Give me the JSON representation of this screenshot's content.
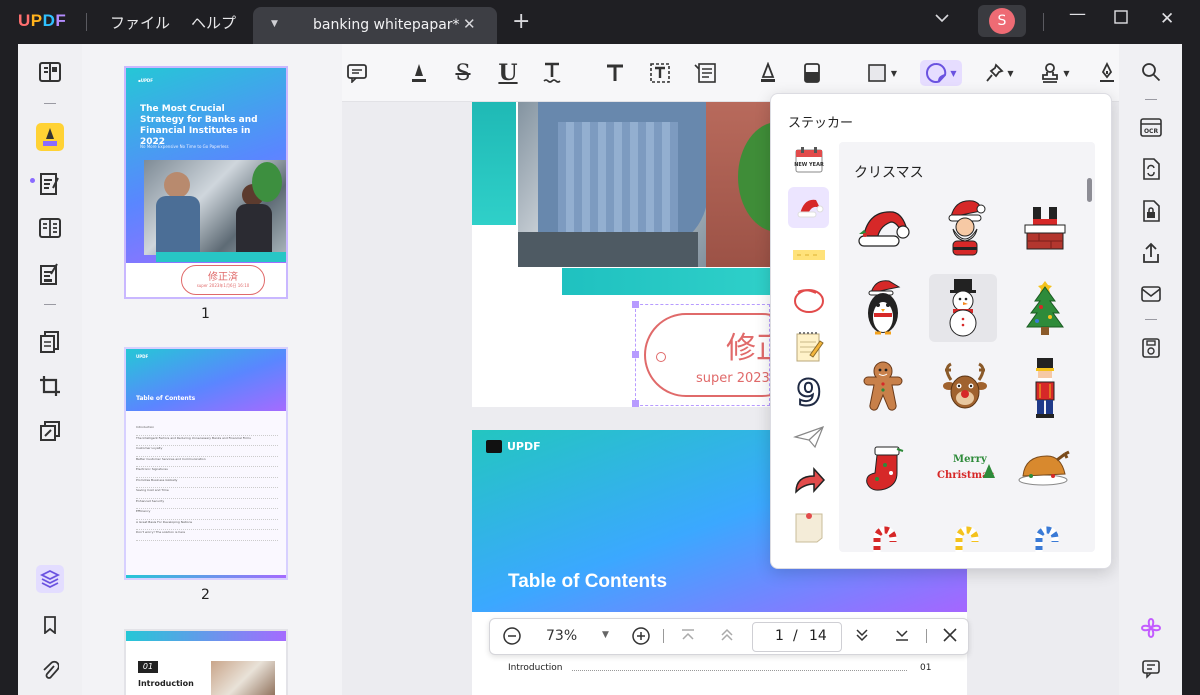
{
  "app": {
    "logo": "UPDF",
    "menus": [
      "ファイル",
      "ヘルプ"
    ],
    "tab_title": "banking whitepapar*",
    "avatar_initial": "S"
  },
  "thumbnails": [
    {
      "page": "1",
      "title": "The Most Crucial Strategy for Banks and Financial Institutes in 2022",
      "subtitle": "No More Expensive No Time to Go Paperless",
      "stamp_main": "修正済",
      "stamp_sub": "super 2023年1月6日 16:10"
    },
    {
      "page": "2",
      "header": "UPDF",
      "title": "Table of Contents",
      "entries": [
        "Introduction",
        "The Intelligent Factors and Reducing Unnecessary Banks and Financial Firms",
        "Customer Loyalty",
        "Better Customer Services and Communication",
        "Electronic Signatures",
        "Promotes Business Globally",
        "Saving Cost and Time",
        "Enhanced Security",
        "Efficiency",
        "A Great Basis For Developing Nations",
        "Don't worry! The solution is here"
      ]
    },
    {
      "page": "3",
      "badge": "01",
      "title": "Introduction"
    }
  ],
  "document": {
    "stamp_main": "修正",
    "stamp_sub": "super 2023年",
    "page2_logo": "UPDF",
    "page2_title": "Table of Contents",
    "toc_first_label": "Introduction",
    "toc_first_page": "01"
  },
  "sticker_panel": {
    "title": "ステッカー",
    "selected_category": "クリスマス",
    "category_icons": [
      "calendar-new-year",
      "santa-hat",
      "washi-tape",
      "red-circle",
      "notepad",
      "number-nine",
      "paper-plane",
      "red-arrow",
      "pinned-note"
    ],
    "new_year_label": "NEW YEAR",
    "merry_line1": "Merry",
    "merry_line2": "Christmas",
    "stickers": [
      "santa-hat",
      "santa-claus",
      "santa-in-chimney",
      "penguin",
      "snowman",
      "christmas-tree",
      "gingerbread-man",
      "reindeer",
      "nutcracker",
      "christmas-stocking",
      "merry-christmas-text",
      "roast-turkey",
      "candy-cane-red",
      "candy-cane-yellow",
      "candy-cane-blue"
    ]
  },
  "zoom": {
    "level": "73%",
    "current_page": "1",
    "separator": "/",
    "total_pages": "14"
  },
  "colors": {
    "accent": "#8a6bff",
    "stamp": "#e06a6a",
    "gradient_start": "#23c6c0",
    "gradient_end": "#a566ff"
  }
}
